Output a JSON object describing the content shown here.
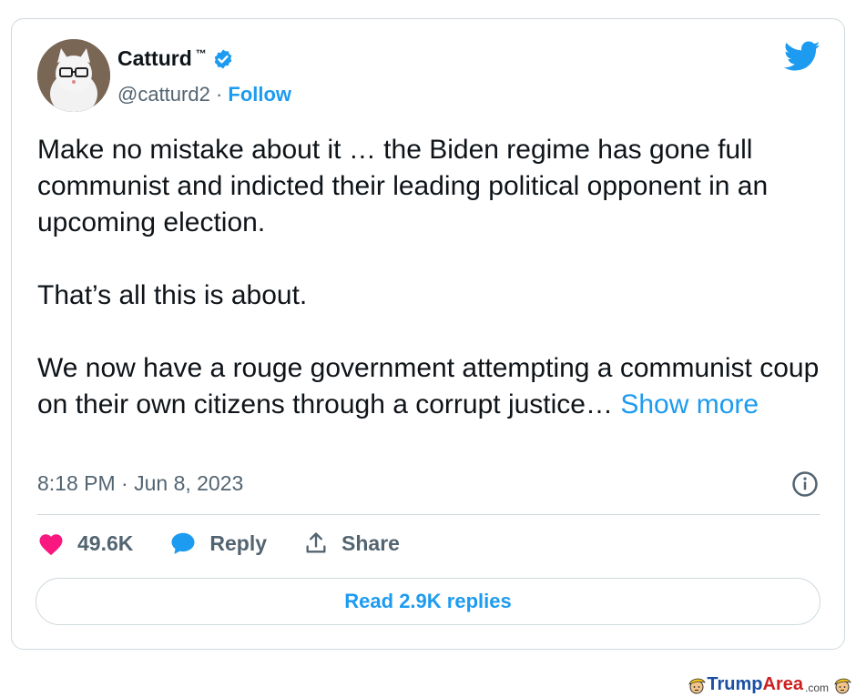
{
  "user": {
    "name": "Catturd",
    "tm": "™",
    "handle": "@catturd2",
    "separator": " · ",
    "follow_label": "Follow"
  },
  "tweet": {
    "paragraphs": [
      "Make no mistake about it … the Biden regime has gone full communist and indicted their leading political opponent in an upcoming election.",
      "That’s all this is about."
    ],
    "last_paragraph": "We now have a rouge government attempting a communist coup on their own citizens through a corrupt justice…",
    "show_more": " Show more",
    "timestamp": "8:18 PM · Jun 8, 2023"
  },
  "actions": {
    "likes": "49.6K",
    "reply_label": "Reply",
    "share_label": "Share"
  },
  "read_replies_label": "Read 2.9K replies",
  "watermark": {
    "trump": "Trump",
    "area": "Area",
    "com": ".com"
  },
  "colors": {
    "accent": "#1d9bf0",
    "like": "#f91880",
    "text": "#0f1419",
    "muted": "#536471",
    "border": "#cfd9de"
  }
}
